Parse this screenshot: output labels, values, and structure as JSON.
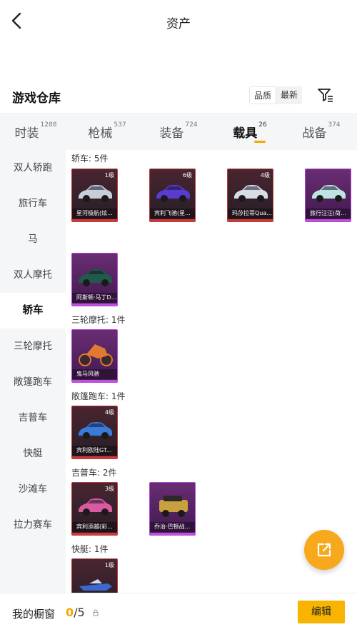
{
  "header": {
    "title": "资产"
  },
  "section": {
    "title": "游戏仓库"
  },
  "sort": {
    "quality": "品质",
    "newest": "最新"
  },
  "tabs": [
    {
      "label": "时装",
      "count": "1288"
    },
    {
      "label": "枪械",
      "count": "537"
    },
    {
      "label": "装备",
      "count": "724"
    },
    {
      "label": "载具",
      "count": "26"
    },
    {
      "label": "战备",
      "count": "374"
    }
  ],
  "sidebar": {
    "items": [
      {
        "label": "双人轿跑"
      },
      {
        "label": "旅行车"
      },
      {
        "label": "马"
      },
      {
        "label": "双人摩托"
      },
      {
        "label": "轿车"
      },
      {
        "label": "三轮摩托"
      },
      {
        "label": "敞篷跑车"
      },
      {
        "label": "吉普车"
      },
      {
        "label": "快艇"
      },
      {
        "label": "沙滩车"
      },
      {
        "label": "拉力赛车"
      }
    ]
  },
  "categories": [
    {
      "label": "轿车: 5件",
      "items": [
        {
          "name": "星河极航(炫...",
          "level": "1级",
          "rarity": "red",
          "color": "#c8cdd8"
        },
        {
          "name": "宾利飞驰(星...",
          "level": "6级",
          "rarity": "red",
          "color": "#5a3bd0"
        },
        {
          "name": "玛莎拉蒂Qua...",
          "level": "4级",
          "rarity": "red",
          "color": "#d8dde5"
        },
        {
          "name": "旅行汪汪(荷...",
          "level": "",
          "rarity": "purple",
          "color": "#bfe3e0"
        },
        {
          "name": "阿斯顿·马丁D...",
          "level": "",
          "rarity": "purple",
          "color": "#1f5a4a"
        }
      ]
    },
    {
      "label": "三轮摩托: 1件",
      "items": [
        {
          "name": "鬼马风驰",
          "level": "",
          "rarity": "purple",
          "color": "#e07a30"
        }
      ]
    },
    {
      "label": "敞篷跑车: 1件",
      "items": [
        {
          "name": "宾利欧陆GT...",
          "level": "4级",
          "rarity": "red",
          "color": "#3a7ad8"
        }
      ]
    },
    {
      "label": "吉普车: 2件",
      "items": [
        {
          "name": "宾利添越(彩...",
          "level": "3级",
          "rarity": "red",
          "color": "#d85aa0"
        },
        {
          "name": "乔治·巴顿战...",
          "level": "",
          "rarity": "purple",
          "color": "#c9a040"
        }
      ]
    },
    {
      "label": "快艇: 1件",
      "items": [
        {
          "name": "",
          "level": "1级",
          "rarity": "red",
          "color": "#3a6ad0"
        }
      ]
    }
  ],
  "bottom": {
    "label": "我的橱窗",
    "current": "0",
    "total": "/5",
    "edit": "编辑"
  },
  "colors": {
    "accent": "#f7b500",
    "tab_bg": "#f5f6f8"
  },
  "icons": {
    "back": "chevron-left-icon",
    "filter": "filter-icon",
    "share": "share-icon",
    "showcase": "lock-icon"
  }
}
